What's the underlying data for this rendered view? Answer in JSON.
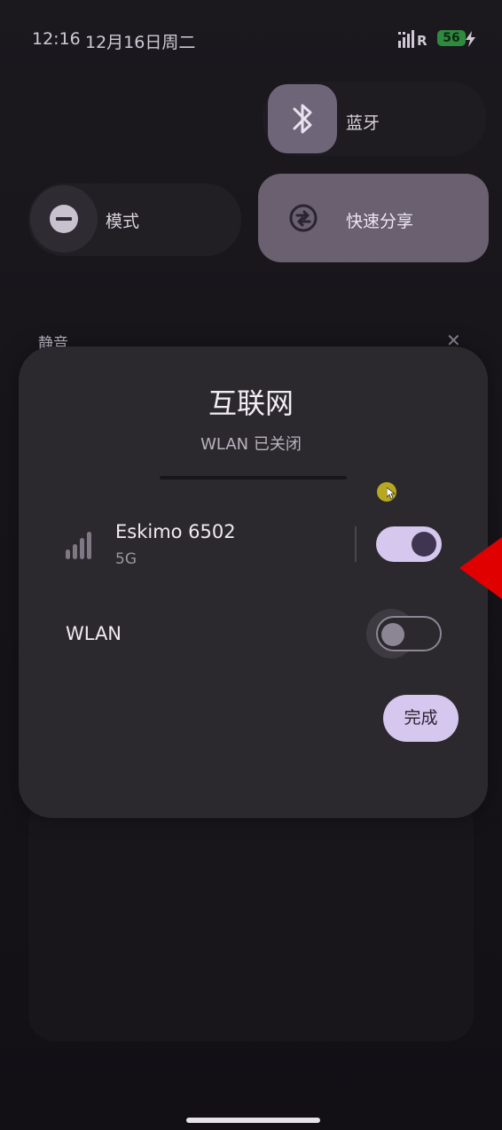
{
  "status_bar": {
    "time": "12:16",
    "date": "12月16日周二",
    "battery_level": "56",
    "signal_icon": "signal-bars-roaming-icon",
    "charging_icon": "charging-bolt-icon"
  },
  "quick_tiles": {
    "bluetooth": {
      "label": "蓝牙",
      "icon": "bluetooth-icon"
    },
    "mode": {
      "label": "模式",
      "icon": "do-not-disturb-icon"
    },
    "quick_share": {
      "label": "快速分享",
      "icon": "quick-share-icon"
    }
  },
  "background_section": {
    "mute_label": "静音",
    "close_glyph": "✕"
  },
  "dialog": {
    "title": "互联网",
    "subtitle": "WLAN 已关闭",
    "network": {
      "name": "Eskimo 6502",
      "band": "5G",
      "enabled": true
    },
    "wlan": {
      "label": "WLAN",
      "enabled": false
    },
    "done_label": "完成"
  },
  "colors": {
    "accent": "#d6c7ee",
    "dialog_background": "#2b292e",
    "page_background": "#151317",
    "battery": "#2e8b3e",
    "annotation_arrow": "#e00000"
  }
}
